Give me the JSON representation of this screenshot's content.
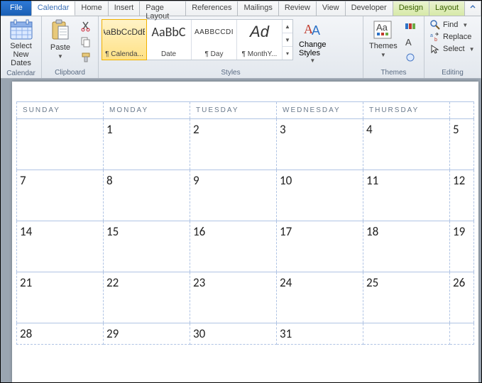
{
  "tabs": {
    "file": "File",
    "list": [
      "Calendar",
      "Home",
      "Insert",
      "Page Layout",
      "References",
      "Mailings",
      "Review",
      "View",
      "Developer"
    ],
    "context": [
      "Design",
      "Layout"
    ],
    "active": "Calendar"
  },
  "ribbon": {
    "calendar_group": {
      "label": "Calendar",
      "select_btn_line1": "Select",
      "select_btn_line2": "New Dates"
    },
    "clipboard_group": {
      "label": "Clipboard",
      "paste": "Paste"
    },
    "styles_group": {
      "label": "Styles",
      "items": [
        {
          "preview": "AaBbCcDdE",
          "label": "¶ Calenda..."
        },
        {
          "preview": "AaBbC",
          "label": "Date"
        },
        {
          "preview": "AABBCCDI",
          "label": "¶ Day"
        },
        {
          "preview": "Ad",
          "label": "¶ MonthY..."
        }
      ],
      "change_styles": "Change\nStyles"
    },
    "themes_group": {
      "label": "Themes",
      "themes": "Themes"
    },
    "editing_group": {
      "label": "Editing",
      "find": "Find",
      "replace": "Replace",
      "select": "Select"
    }
  },
  "calendar": {
    "headers": [
      "SUNDAY",
      "MONDAY",
      "TUESDAY",
      "WEDNESDAY",
      "THURSDAY",
      ""
    ],
    "weeks": [
      [
        "",
        "1",
        "2",
        "3",
        "4",
        "5"
      ],
      [
        "7",
        "8",
        "9",
        "10",
        "11",
        "12"
      ],
      [
        "14",
        "15",
        "16",
        "17",
        "18",
        "19"
      ],
      [
        "21",
        "22",
        "23",
        "24",
        "25",
        "26"
      ],
      [
        "28",
        "29",
        "30",
        "31",
        "",
        ""
      ]
    ]
  }
}
